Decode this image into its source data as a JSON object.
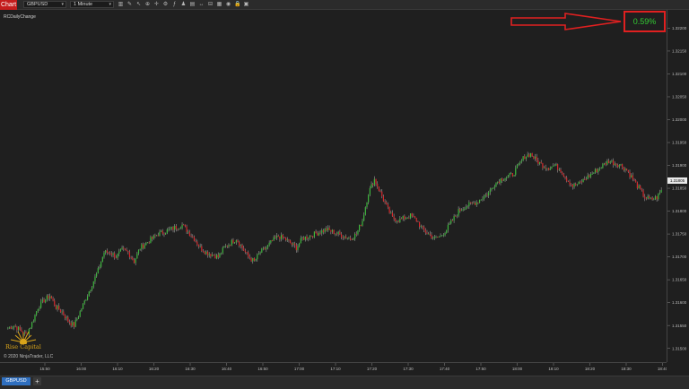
{
  "toolbar": {
    "tab_label": "Chart",
    "instrument": "GBPUSD",
    "interval": "1 Minute",
    "icons": [
      "bar-type-icon",
      "drawing-icon",
      "pointer-icon",
      "zoom-icon",
      "crosshair-icon",
      "properties-icon",
      "indicators-icon",
      "strategies-icon",
      "templates-icon",
      "scroll-icon",
      "split-icon",
      "data-box-icon",
      "snapshot-icon",
      "lock-icon",
      "chart-trader-icon"
    ]
  },
  "indicator_label": "RCDailyChange",
  "daily_change": "0.59%",
  "last_price": "1.31805",
  "brand": "Rise Capital",
  "copyright": "© 2020 NinjaTrader, LLC",
  "instrument_tab": "GBPUSD",
  "add_tab": "+",
  "colors": {
    "up": "#3cba3c",
    "down": "#d9262a",
    "accent": "#c41d1d",
    "highlight": "#e02020"
  },
  "chart_data": {
    "type": "candlestick",
    "price_axis_labels": [
      "1.32200",
      "1.32150",
      "1.32100",
      "1.32050",
      "1.32000",
      "1.31950",
      "1.31900",
      "1.31850",
      "1.31800",
      "1.31750",
      "1.31700",
      "1.31650",
      "1.31600",
      "1.31550",
      "1.31500"
    ],
    "time_axis_labels": [
      "15:50",
      "16:00",
      "16:10",
      "16:20",
      "16:30",
      "16:40",
      "16:50",
      "17:00",
      "17:10",
      "17:20",
      "17:30",
      "17:40",
      "17:50",
      "18:00",
      "18:10",
      "18:20",
      "18:30",
      "18:40"
    ],
    "ylim": [
      1.3147,
      1.3224
    ],
    "candles_mid": [
      1.31545,
      1.3155,
      1.3154,
      1.3153,
      1.31555,
      1.3159,
      1.31605,
      1.31615,
      1.3159,
      1.3158,
      1.3156,
      1.3155,
      1.3158,
      1.3161,
      1.3164,
      1.3167,
      1.3171,
      1.3171,
      1.317,
      1.31715,
      1.3171,
      1.3169,
      1.3172,
      1.3173,
      1.3174,
      1.3175,
      1.31755,
      1.3176,
      1.31765,
      1.3177,
      1.31755,
      1.3174,
      1.3172,
      1.3171,
      1.31705,
      1.317,
      1.3172,
      1.3173,
      1.3174,
      1.3172,
      1.317,
      1.3169,
      1.3171,
      1.3172,
      1.31735,
      1.31745,
      1.3174,
      1.3173,
      1.3172,
      1.3174,
      1.31745,
      1.3175,
      1.31755,
      1.3176,
      1.31755,
      1.3175,
      1.31745,
      1.3174,
      1.3175,
      1.3178,
      1.3184,
      1.3187,
      1.3184,
      1.3181,
      1.31785,
      1.3178,
      1.31785,
      1.3179,
      1.3178,
      1.3176,
      1.3175,
      1.3174,
      1.31745,
      1.3176,
      1.3178,
      1.318,
      1.3181,
      1.31815,
      1.3182,
      1.3183,
      1.3184,
      1.3186,
      1.3187,
      1.31875,
      1.3188,
      1.319,
      1.3192,
      1.31925,
      1.3191,
      1.319,
      1.31895,
      1.319,
      1.3189,
      1.3187,
      1.31855,
      1.3186,
      1.3187,
      1.3188,
      1.3189,
      1.319,
      1.3191,
      1.31905,
      1.319,
      1.3189,
      1.3187,
      1.3185,
      1.3183,
      1.31825,
      1.3183,
      1.3185
    ]
  }
}
